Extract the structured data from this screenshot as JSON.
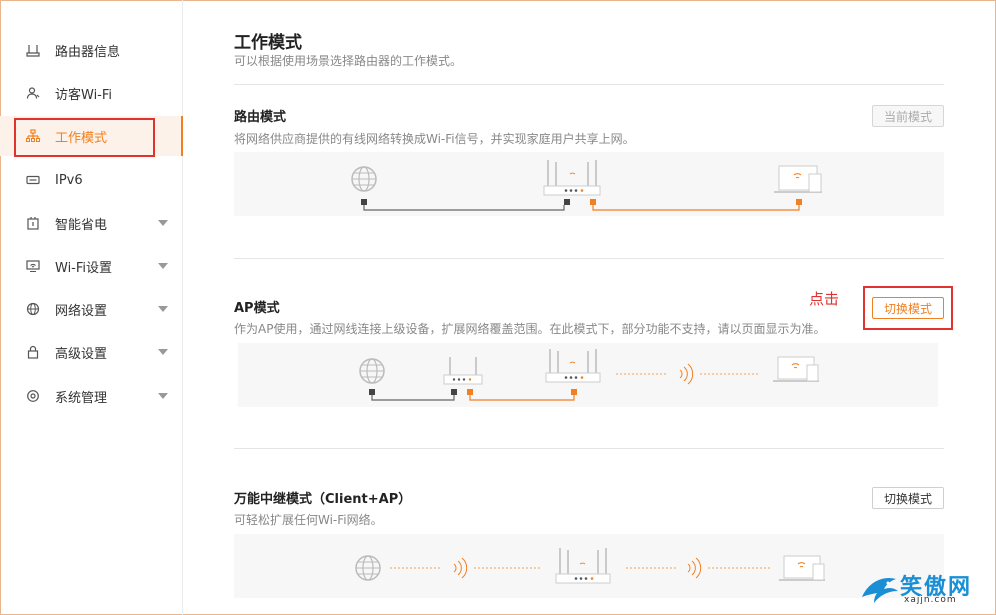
{
  "sidebar": {
    "items": [
      {
        "label": "路由器信息",
        "icon": "router-icon",
        "has_caret": false
      },
      {
        "label": "访客Wi-Fi",
        "icon": "guest-user-icon",
        "has_caret": false
      },
      {
        "label": "工作模式",
        "icon": "network-topology-icon",
        "has_caret": false,
        "active": true
      },
      {
        "label": "IPv6",
        "icon": "ipv6-icon",
        "has_caret": false
      },
      {
        "label": "智能省电",
        "icon": "power-save-icon",
        "has_caret": true
      },
      {
        "label": "Wi-Fi设置",
        "icon": "wifi-monitor-icon",
        "has_caret": true
      },
      {
        "label": "网络设置",
        "icon": "globe-icon",
        "has_caret": true
      },
      {
        "label": "高级设置",
        "icon": "lock-icon",
        "has_caret": true
      },
      {
        "label": "系统管理",
        "icon": "gear-icon",
        "has_caret": true
      }
    ]
  },
  "main": {
    "title": "工作模式",
    "subtitle": "可以根据使用场景选择路由器的工作模式。",
    "sections": [
      {
        "title": "路由模式",
        "desc": "将网络供应商提供的有线网络转换成Wi-Fi信号，并实现家庭用户共享上网。",
        "button": "当前模式"
      },
      {
        "title": "AP模式",
        "desc": "作为AP使用，通过网线连接上级设备，扩展网络覆盖范围。在此模式下，部分功能不支持，请以页面显示为准。",
        "button": "切换模式"
      },
      {
        "title": "万能中继模式（Client+AP）",
        "desc": "可轻松扩展任何Wi-Fi网络。",
        "button": "切换模式"
      }
    ]
  },
  "annotation": {
    "click_hint": "点击"
  },
  "watermark": {
    "text": "笑傲网",
    "url": "xajjn.com"
  },
  "colors": {
    "accent": "#f08021",
    "highlight": "#e0322f",
    "watermark": "#1a8fd6"
  }
}
